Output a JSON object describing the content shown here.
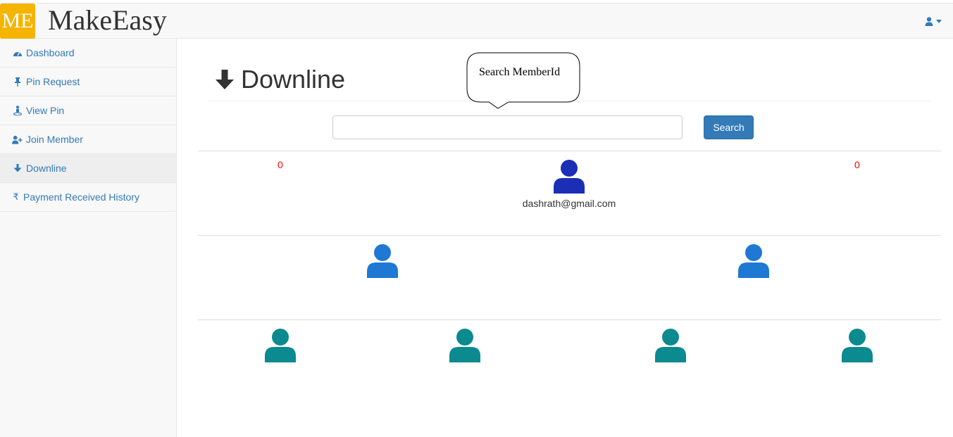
{
  "header": {
    "logo_text": "ME",
    "brand_name": "MakeEasy",
    "user_icon": "user-icon"
  },
  "sidebar": {
    "items": [
      {
        "label": "Dashboard",
        "icon": "tachometer-icon"
      },
      {
        "label": "Pin Request",
        "icon": "thumbtack-icon"
      },
      {
        "label": "View Pin",
        "icon": "street-view-icon"
      },
      {
        "label": "Join Member",
        "icon": "user-plus-icon"
      },
      {
        "label": "Downline",
        "icon": "arrow-down-icon"
      },
      {
        "label": "Payment Received History",
        "icon": "rupee-icon"
      }
    ],
    "active_index": 4
  },
  "main": {
    "title": "Downline",
    "tooltip": "Search MemberId",
    "search": {
      "value": "",
      "placeholder": "",
      "button_label": "Search"
    },
    "tree": {
      "root": {
        "email": "dashrath@gmail.com",
        "left_count": "0",
        "right_count": "0"
      }
    }
  },
  "colors": {
    "accent": "#337ab7",
    "logo_bg": "#f5b400",
    "root_member": "#1a2fb5",
    "level1_member": "#1e78d4",
    "level2_member": "#0b8a8f",
    "count_text": "#ff0000"
  }
}
